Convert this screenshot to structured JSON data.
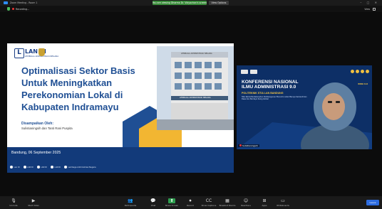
{
  "window": {
    "title": "Zoom Meeting - Room 1",
    "share_banner": "You are viewing Dharma Dr. Vidyachan's screen",
    "view_options": "View Options",
    "controls": "– □ ✕"
  },
  "status": {
    "recording": "Recording...",
    "view_label": "View"
  },
  "slide": {
    "logo_mark": "L",
    "logo_text": "LAN RI",
    "logo_sub": "LEMBAGA ADMINISTRASI NEGARA",
    "title": "Optimalisasi Sektor Basis Untuk Meningkatkan Perekonomian Lokal di Kabupaten Indramayu",
    "presented_by_label": "Disampaikan Oleh:",
    "presenters": "Sulistianingsih dan Tanti Rani Puspita",
    "date": "Bandung, 06 September 2025",
    "building_sign_top": "LEMBAGA ADMINISTRASI NEGARA",
    "building_sign_mid": "LEMBAGA ADMINISTRASI NEGARA",
    "socials": [
      {
        "label": "Lan RI"
      },
      {
        "label": "LAN RI"
      },
      {
        "label": "LAN RI"
      },
      {
        "label": "LAN RI"
      },
      {
        "label": "Lembaga Administrasi Negara"
      }
    ]
  },
  "video": {
    "konferensi_line1": "KONFERENSI NASIONAL",
    "konferensi_line2": "ILMU ADMINISTRASI 9.0",
    "konferensi_sub": "POLITEKNIK STIA LAN BANDUNG",
    "konferensi_desc": "Tata Kelola Berkelanjutan Pembangunan Ekonomi Lokal Menuju Kemandirian Desa dan Berdaya Saing Global",
    "tag": "KNIA 9.0",
    "participant_name": "Sulistianingsih"
  },
  "toolbar": {
    "items": [
      {
        "label": "Unmute",
        "icon": "mic-icon",
        "glyph": "🎙"
      },
      {
        "label": "Start Video",
        "icon": "video-icon",
        "glyph": "▶"
      },
      {
        "label": "Participants",
        "icon": "participants-icon",
        "glyph": "👥"
      },
      {
        "label": "Chat",
        "icon": "chat-icon",
        "glyph": "💬"
      },
      {
        "label": "Share Screen",
        "icon": "share-icon",
        "glyph": "⬆"
      },
      {
        "label": "Record",
        "icon": "record-icon",
        "glyph": "⏺"
      },
      {
        "label": "Show Captions",
        "icon": "captions-icon",
        "glyph": "CC"
      },
      {
        "label": "Breakout Rooms",
        "icon": "breakout-icon",
        "glyph": "▦"
      },
      {
        "label": "Reactions",
        "icon": "reactions-icon",
        "glyph": "☺"
      },
      {
        "label": "Apps",
        "icon": "apps-icon",
        "glyph": "⊞"
      },
      {
        "label": "Whiteboards",
        "icon": "whiteboard-icon",
        "glyph": "▭"
      }
    ],
    "end_label": "Leave"
  }
}
